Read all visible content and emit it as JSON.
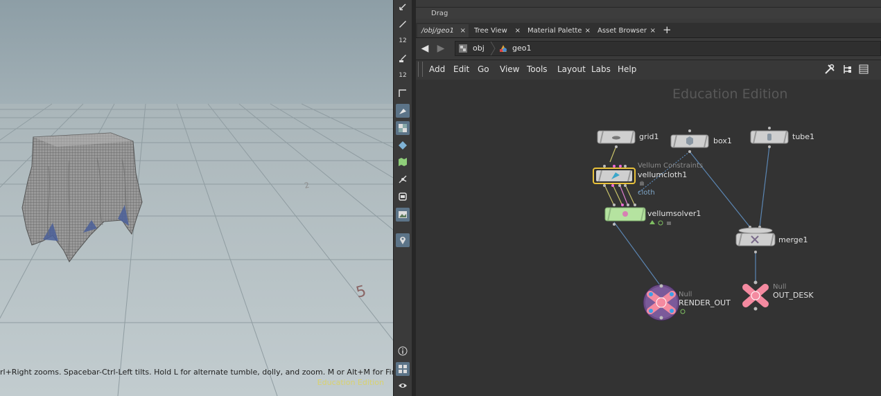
{
  "viewport": {
    "status_text": "rl+Right zooms. Spacebar-Ctrl-Left tilts. Hold L for alternate tumble, dolly, and zoom. M or Alt+M for First Person",
    "watermark": "Education Edition",
    "grid_numbers": [
      "2",
      "5"
    ]
  },
  "toolbar": {
    "icons": [
      "select-arrow-icon",
      "pick-brush-icon",
      "number-12-icon",
      "paint-brush-icon",
      "number-12-alt-icon",
      "corner-icon",
      "pen-icon",
      "checker-icon",
      "diamond-icon",
      "map-icon",
      "snap-icon",
      "square-icon",
      "image-icon",
      "pin-icon",
      "info-icon",
      "layout-grid-icon",
      "eye-icon"
    ],
    "badge_a": "12",
    "badge_b": "12"
  },
  "pane": {
    "drag_label": "Drag",
    "tabs": [
      {
        "label": "/obj/geo1",
        "close": "×"
      },
      {
        "label": "Tree View",
        "close": "×"
      },
      {
        "label": "Material Palette",
        "close": "×"
      },
      {
        "label": "Asset Browser",
        "close": "×"
      }
    ],
    "add_tab": "+"
  },
  "path": {
    "back": "◀",
    "forward": "▶",
    "crumbs": [
      "obj",
      "geo1"
    ]
  },
  "menu": {
    "items": [
      "Add",
      "Edit",
      "Go",
      "View",
      "Tools",
      "Layout",
      "Labs",
      "Help"
    ]
  },
  "network": {
    "watermark": "Education Edition",
    "nodes": {
      "grid": {
        "name": "grid1"
      },
      "box": {
        "name": "box1"
      },
      "tube": {
        "name": "tube1"
      },
      "cloth": {
        "name": "vellumcloth1",
        "subtitle": "Vellum Constraints",
        "link": "cloth"
      },
      "solver": {
        "name": "vellumsolver1"
      },
      "merge": {
        "name": "merge1"
      },
      "render_out": {
        "name": "RENDER_OUT",
        "type": "Null"
      },
      "out_desk": {
        "name": "OUT_DESK",
        "type": "Null"
      }
    },
    "colors": {
      "wire": "#5b86b3",
      "node_gray": "#cfcfcf",
      "solver_green": "#b5e3a0",
      "select_yellow": "#e9c23a",
      "null_pink": "#f48aa0",
      "render_purple": "#6b4a86"
    }
  }
}
